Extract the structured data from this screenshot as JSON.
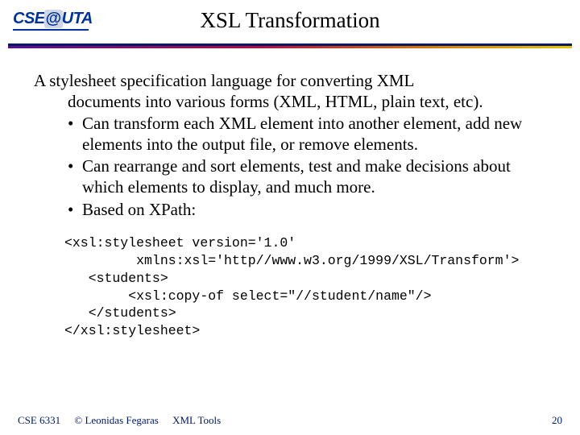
{
  "header": {
    "logo_text_1": "CSE",
    "logo_at": "@",
    "logo_text_2": "UTA",
    "title": "XSL Transformation"
  },
  "body": {
    "intro_line1": "A stylesheet specification language for converting XML",
    "intro_line2": "documents into various forms (XML, HTML, plain text, etc).",
    "bullets": [
      "Can transform each XML element into another element, add new elements into the output file, or remove elements.",
      "Can rearrange and sort elements, test and make decisions about which elements to display, and much more.",
      "Based on XPath:"
    ],
    "code": "<xsl:stylesheet version='1.0'\n         xmlns:xsl='http//www.w3.org/1999/XSL/Transform'>\n   <students>\n        <xsl:copy-of select=\"//student/name\"/>\n   </students>\n</xsl:stylesheet>"
  },
  "footer": {
    "course": "CSE 6331",
    "copyright": "© Leonidas Fegaras",
    "topic": "XML Tools",
    "page": "20"
  }
}
